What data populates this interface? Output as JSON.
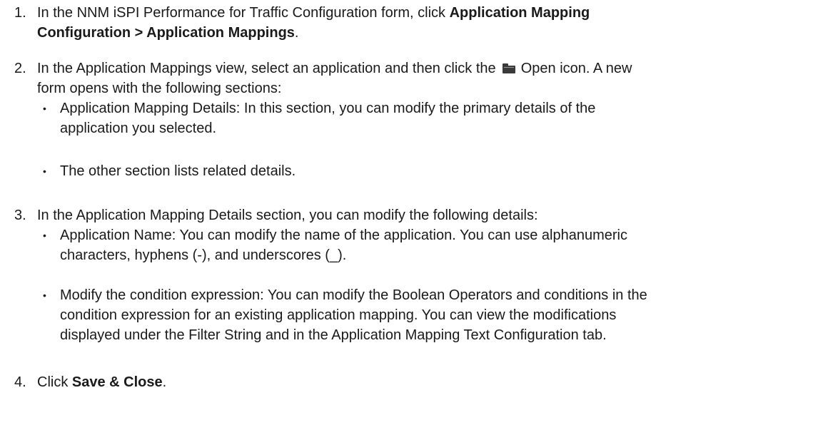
{
  "steps": [
    {
      "num": "1.",
      "pre": "In the NNM iSPI Performance for Traffic Configuration form, click ",
      "bold": "Application Mapping",
      "line2_bold": "Configuration > Application Mappings",
      "line2_post": "."
    },
    {
      "num": "2.",
      "line1_pre": "In the Application Mappings view, select an application and then click the ",
      "icon": "folder-icon",
      "line1_post": " Open icon. A new",
      "line2": "form opens with the following sections:",
      "bullets": [
        {
          "line1": "Application Mapping Details: In this section, you can modify the primary details of the",
          "line2": "application you selected."
        },
        {
          "line1": "The other section lists related details."
        }
      ]
    },
    {
      "num": "3.",
      "line1": "In the Application Mapping Details section, you can modify the following details:",
      "bullets": [
        {
          "line1": "Application Name: You can modify the name of the application. You can use alphanumeric",
          "line2": "characters, hyphens (-), and underscores (_)."
        },
        {
          "line1": "Modify the condition expression: You can modify the Boolean Operators and conditions in the",
          "line2": "condition expression for an existing application mapping. You can view the modifications",
          "line3": "displayed under the Filter String and in the Application Mapping Text Configuration tab."
        }
      ]
    },
    {
      "num": "4.",
      "pre": "Click ",
      "bold": "Save & Close",
      "post": "."
    }
  ],
  "bullet_glyph": "•"
}
